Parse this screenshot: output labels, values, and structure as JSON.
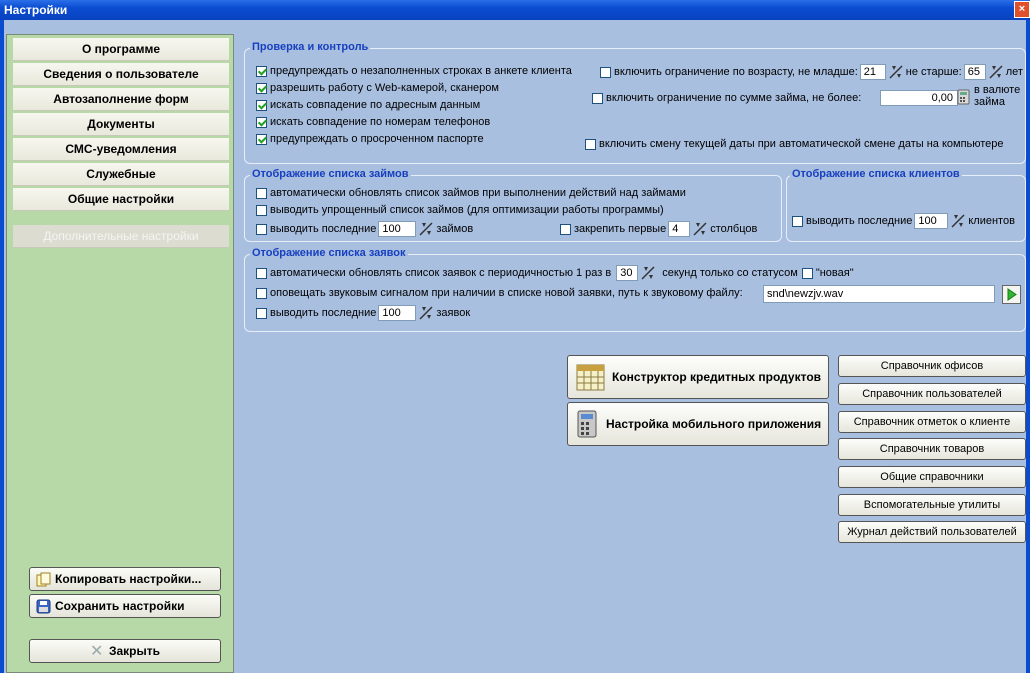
{
  "window": {
    "title": "Настройки",
    "close": "×"
  },
  "sidebar": {
    "items": [
      {
        "label": "О программе"
      },
      {
        "label": "Сведения о пользователе"
      },
      {
        "label": "Автозаполнение форм"
      },
      {
        "label": "Документы"
      },
      {
        "label": "СМС-уведомления"
      },
      {
        "label": "Служебные"
      },
      {
        "label": "Общие настройки"
      },
      {
        "label": "Дополнительные настройки",
        "active": true
      }
    ],
    "copy_label": "Копировать настройки...",
    "save_label": "Сохранить настройки",
    "close_label": "Закрыть"
  },
  "check": {
    "title": "Проверка и контроль",
    "warn_empty": "предупреждать о незаполненных строках в анкете клиента",
    "webcam": "разрешить работу с Web-камерой, сканером",
    "match_address": "искать совпадение по адресным данным",
    "match_phone": "искать совпадение по номерам телефонов",
    "warn_passport": "предупреждать о просроченном паспорте",
    "age_limit": "включить ограничение по возрасту, не младше:",
    "age_min": "21",
    "age_not_older": "не старше:",
    "age_max": "65",
    "age_unit": "лет",
    "sum_limit": "включить ограничение по сумме займа, не более:",
    "sum_value": "0,00",
    "sum_currency_1": "в валюте",
    "sum_currency_2": "займа",
    "date_change": "включить смену текущей даты при автоматической смене даты на компьютере"
  },
  "loans": {
    "title": "Отображение списка займов",
    "auto_refresh": "автоматически обновлять список займов при выполнении действий над займами",
    "simple_list": "выводить упрощенный список займов (для оптимизации работы программы)",
    "show_last": "выводить последние",
    "show_last_value": "100",
    "show_last_unit": "займов",
    "fix_first": "закрепить первые",
    "fix_first_value": "4",
    "fix_first_unit": "столбцов"
  },
  "clients": {
    "title": "Отображение списка клиентов",
    "show_last": "выводить последние",
    "show_last_value": "100",
    "show_last_unit": "клиентов"
  },
  "requests": {
    "title": "Отображение списка заявок",
    "auto_refresh": "автоматически обновлять список заявок с периодичностью 1 раз в",
    "period_value": "30",
    "period_unit": "секунд только со статусом",
    "status": "\"новая\"",
    "sound": "оповещать звуковым сигналом при наличии в списке новой заявки, путь к звуковому файлу:",
    "sound_path": "snd\\newzjv.wav",
    "show_last": "выводить последние",
    "show_last_value": "100",
    "show_last_unit": "заявок"
  },
  "buttons": {
    "credit_constructor": "Конструктор кредитных продуктов",
    "mobile_app": "Настройка мобильного приложения"
  },
  "refs": [
    {
      "label": "Справочник офисов"
    },
    {
      "label": "Справочник пользователей"
    },
    {
      "label": "Справочник отметок о клиенте"
    },
    {
      "label": "Справочник товаров"
    },
    {
      "label": "Общие справочники"
    },
    {
      "label": "Вспомогательные утилиты"
    },
    {
      "label": "Журнал действий пользователей"
    }
  ],
  "icons": [
    "calendar-icon",
    "calculator-icon",
    "copy-icon",
    "floppy-icon",
    "close-x-icon",
    "spin-icon",
    "play-icon"
  ]
}
